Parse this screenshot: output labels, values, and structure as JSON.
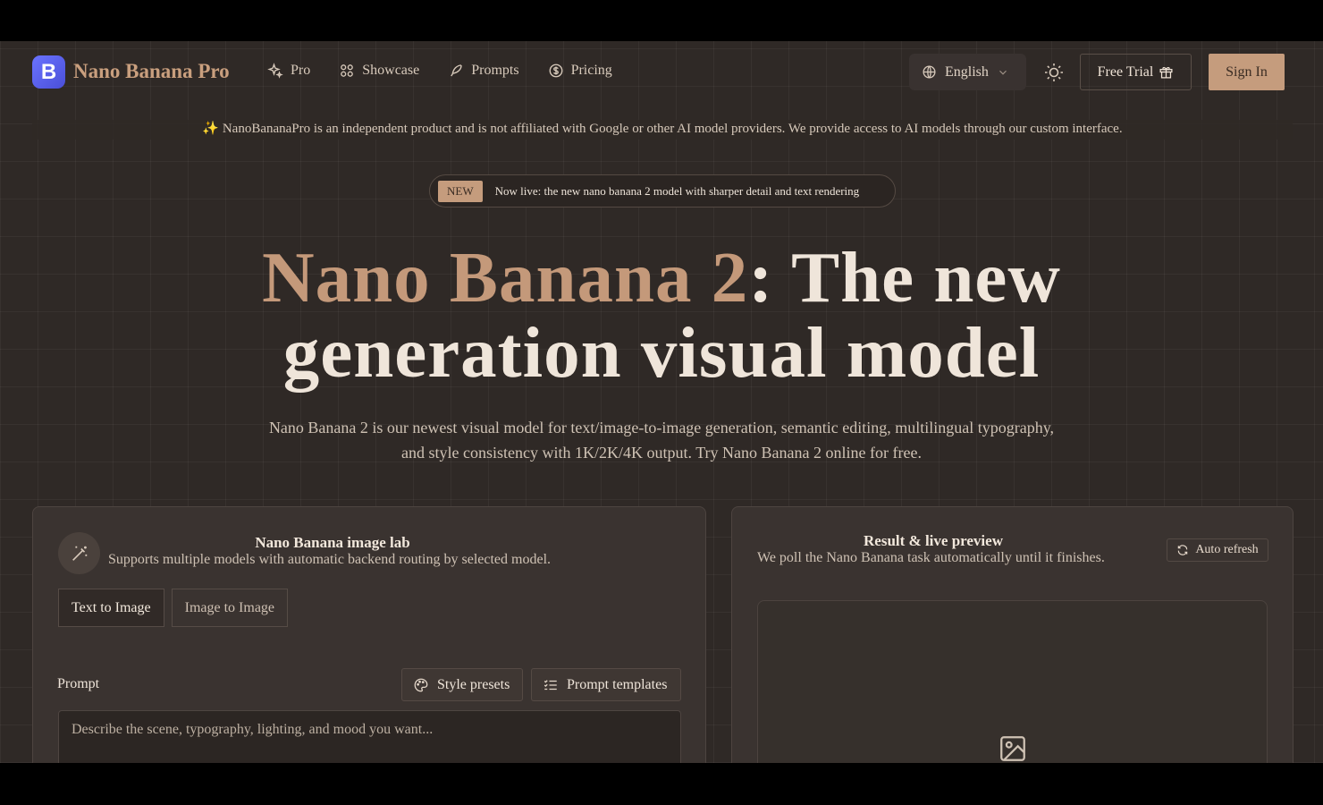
{
  "header": {
    "logo_letter": "B",
    "brand": "Nano Banana Pro",
    "nav": [
      {
        "label": "Pro",
        "icon": "sparkle-icon"
      },
      {
        "label": "Showcase",
        "icon": "grid-icon"
      },
      {
        "label": "Prompts",
        "icon": "feather-icon"
      },
      {
        "label": "Pricing",
        "icon": "dollar-icon"
      }
    ],
    "language": "English",
    "free_trial": "Free Trial",
    "sign_in": "Sign In"
  },
  "notice": "✨ NanoBananaPro is an independent product and is not affiliated with Google or other AI model providers. We provide access to AI models through our custom interface.",
  "announcement": {
    "badge": "NEW",
    "text": "Now live: the new nano banana 2 model with sharper detail and text rendering"
  },
  "hero": {
    "title_accent": "Nano Banana 2",
    "title_rest_line1": ": The new",
    "title_line2": "generation visual model",
    "subtitle": "Nano Banana 2 is our newest visual model for text/image-to-image generation, semantic editing, multilingual typography, and style consistency with 1K/2K/4K output. Try Nano Banana 2 online for free."
  },
  "lab": {
    "title": "Nano Banana image lab",
    "subtitle": "Supports multiple models with automatic backend routing by selected model.",
    "tabs": [
      "Text to Image",
      "Image to Image"
    ],
    "prompt_label": "Prompt",
    "style_presets": "Style presets",
    "prompt_templates": "Prompt templates",
    "prompt_placeholder": "Describe the scene, typography, lighting, and mood you want..."
  },
  "result": {
    "title": "Result & live preview",
    "subtitle": "We poll the Nano Banana task automatically until it finishes.",
    "auto_refresh": "Auto refresh"
  },
  "colors": {
    "accent": "#c59c7d",
    "background": "#2f2926",
    "logo": "#5a62f0"
  }
}
